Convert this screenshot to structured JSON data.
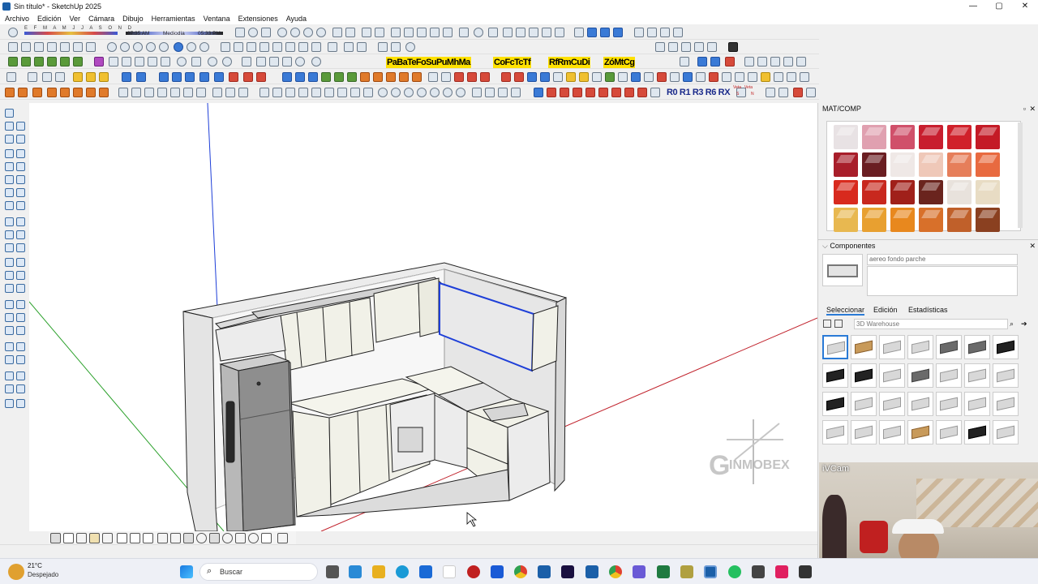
{
  "window": {
    "title": "Sin título* - SketchUp 2025",
    "controls": [
      "—",
      "▢",
      "✕"
    ]
  },
  "menu": [
    "Archivo",
    "Edición",
    "Ver",
    "Cámara",
    "Dibujo",
    "Herramientas",
    "Ventana",
    "Extensiones",
    "Ayuda"
  ],
  "shadows": {
    "months": "E F M A M J J A S O N D",
    "time_start": "07:35 AM",
    "time_mid": "Mediodía",
    "time_end": "05:33 PM"
  },
  "yellow_toolbar": [
    "PaBaTeFoSuPuMhMa",
    "CoFcTcTf",
    "RfRmCuDi",
    "ZóMtCg"
  ],
  "rotate_toolbar": "R0 R1 R3 R6 RX",
  "veta_labels": [
    "Veta",
    "Veta",
    "S",
    "N"
  ],
  "panels": {
    "materials": {
      "title": "MAT/COMP",
      "swatch_colors": [
        "#e8e2e4",
        "#e0a0b0",
        "#d0506a",
        "#c81e2e",
        "#d0202a",
        "#c41a26",
        "#a81e2a",
        "#6a1e22",
        "#efe8e6",
        "#efc8b8",
        "#e67e5a",
        "#e86a40",
        "#d82a1e",
        "#c8281e",
        "#a0201a",
        "#6a241e",
        "#e8e2dc",
        "#e8dcc4",
        "#e8b850",
        "#e8a030",
        "#e8881e",
        "#d8702a",
        "#c0602a",
        "#8a4020"
      ]
    },
    "components": {
      "title": "Componentes",
      "name_value": "aereo fondo parche",
      "tabs": [
        "Seleccionar",
        "Edición",
        "Estadísticas"
      ],
      "search_placeholder": "3D Warehouse"
    }
  },
  "viewport": {
    "watermark": "INMOBEX",
    "watermark_prefix": "G"
  },
  "webcam": {
    "label": "iVCam"
  },
  "weather": {
    "temp": "21°C",
    "condition": "Despejado"
  },
  "taskbar": {
    "search_placeholder": "Buscar"
  },
  "colors": {
    "accent": "#1e3fd8",
    "selection": "#0000ff",
    "red_axis": "#c0202a",
    "green_axis": "#2aa02a"
  }
}
